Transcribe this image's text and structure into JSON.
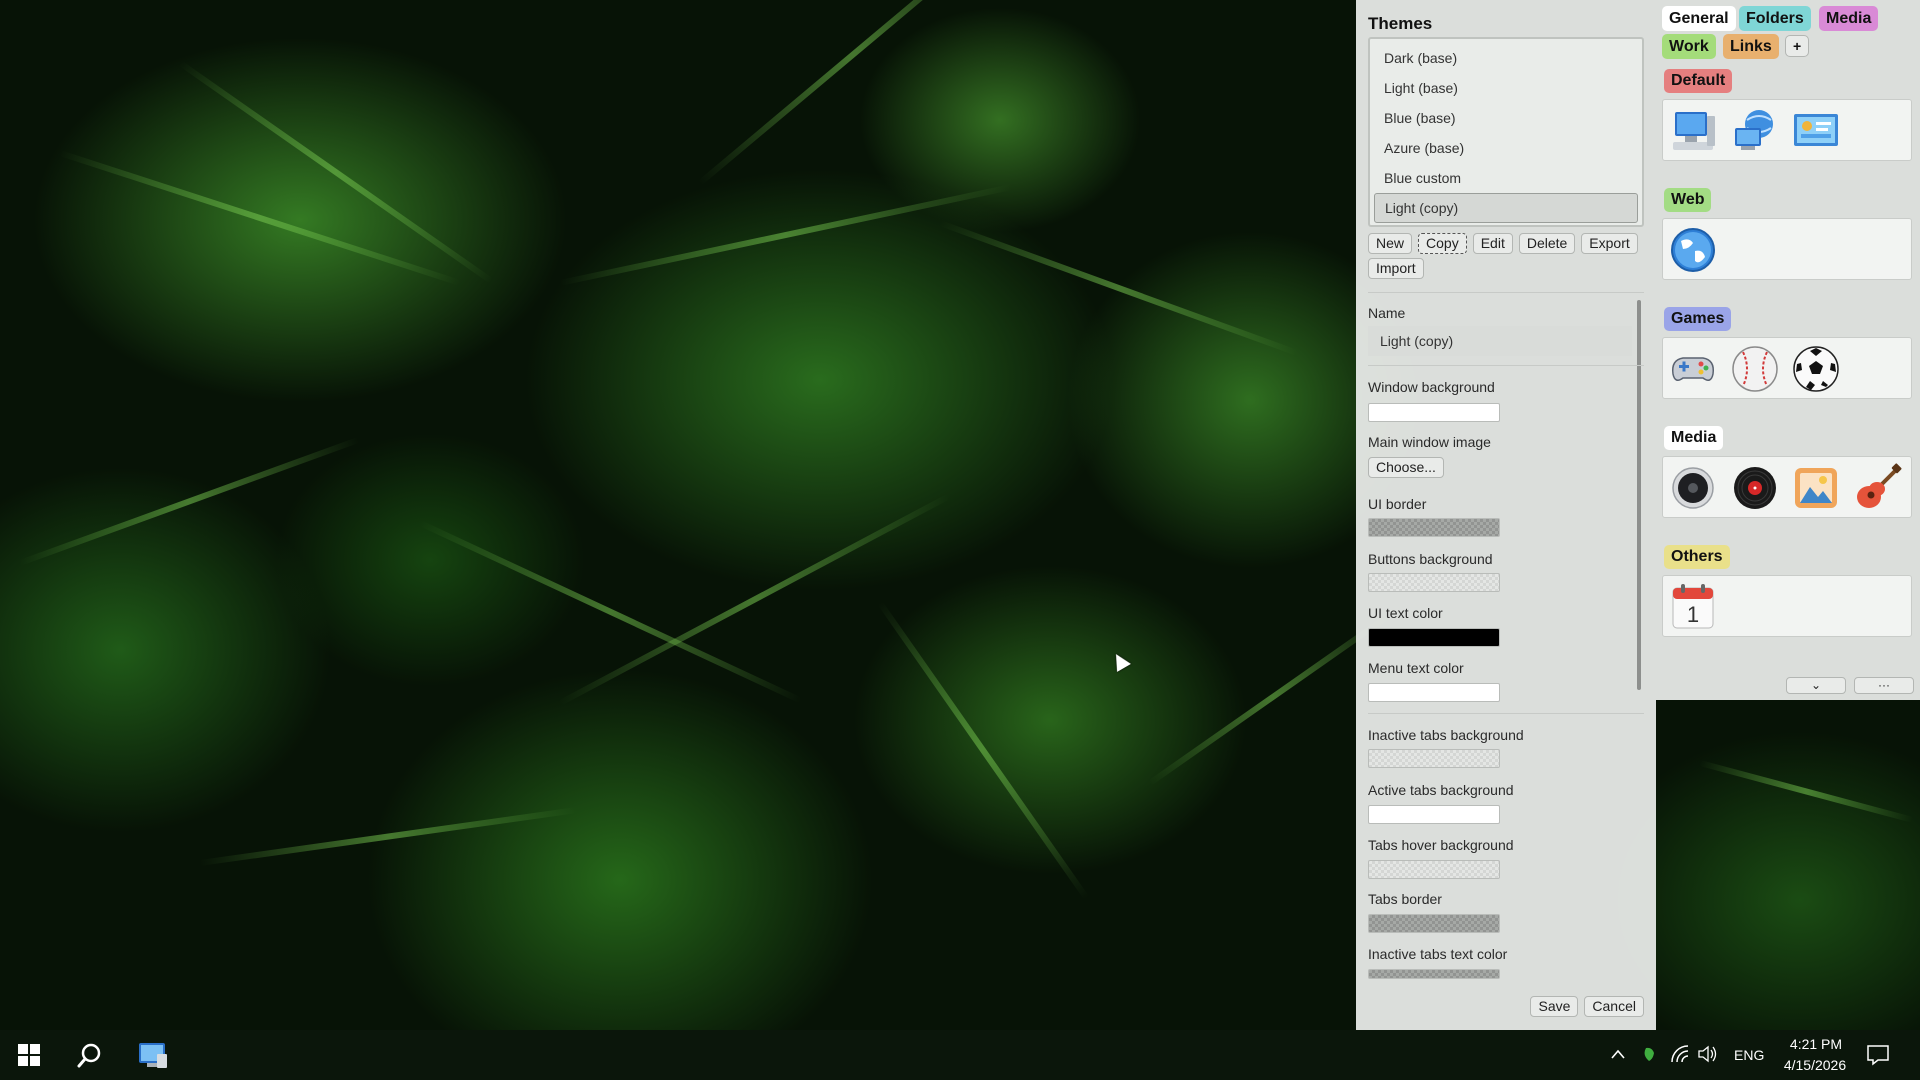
{
  "theme_editor": {
    "title": "Themes",
    "themes": [
      "Dark (base)",
      "Light (base)",
      "Blue (base)",
      "Azure (base)",
      "Blue custom",
      "Light (copy)"
    ],
    "selected_theme": "Light (copy)",
    "actions": {
      "new": "New",
      "copy": "Copy",
      "edit": "Edit",
      "delete": "Delete",
      "export": "Export",
      "import": "Import"
    },
    "fields": {
      "name_label": "Name",
      "name_value": "Light (copy)",
      "window_background": "Window background",
      "main_window_image": "Main window image",
      "choose": "Choose...",
      "ui_border": "UI border",
      "buttons_background": "Buttons background",
      "ui_text_color": "UI text color",
      "menu_text_color": "Menu text color",
      "inactive_tabs_background": "Inactive tabs background",
      "active_tabs_background": "Active tabs background",
      "tabs_hover_background": "Tabs hover background",
      "tabs_border": "Tabs border",
      "inactive_tabs_text_color": "Inactive tabs text color"
    },
    "save": "Save",
    "cancel": "Cancel"
  },
  "launcher": {
    "tabs": [
      {
        "label": "General",
        "color": "#ffffff"
      },
      {
        "label": "Folders",
        "color": "#7fd6d6"
      },
      {
        "label": "Media",
        "color": "#d98ad6"
      },
      {
        "label": "Work",
        "color": "#a4dc7a"
      },
      {
        "label": "Links",
        "color": "#e8b06e"
      },
      {
        "label": "+",
        "color": "#e9ebe9"
      }
    ],
    "groups": [
      {
        "label": "Default",
        "color": "#e57f7f",
        "icons": [
          "computer-icon",
          "network-globe-icon",
          "control-panel-icon"
        ]
      },
      {
        "label": "Web",
        "color": "#a3dc84",
        "icons": [
          "browser-globe-icon"
        ]
      },
      {
        "label": "Games",
        "color": "#9aa4e8",
        "icons": [
          "gamepad-icon",
          "baseball-icon",
          "soccer-ball-icon"
        ]
      },
      {
        "label": "Media",
        "color": "#ffffff",
        "icons": [
          "speaker-icon",
          "vinyl-record-icon",
          "photos-icon",
          "guitar-icon"
        ]
      },
      {
        "label": "Others",
        "color": "#e9e08a",
        "icons": [
          "calendar-icon"
        ]
      }
    ],
    "calendar_day": "1",
    "footer": {
      "expand": "⌄",
      "more": "···"
    }
  },
  "taskbar": {
    "language": "ENG",
    "time": "4:21 PM",
    "date": "4/15/2026",
    "icons": [
      "windows-start-icon",
      "search-icon",
      "launcher-app-icon",
      "chevron-up-icon",
      "leaf-tray-icon",
      "wifi-icon",
      "volume-icon",
      "notification-icon"
    ]
  }
}
